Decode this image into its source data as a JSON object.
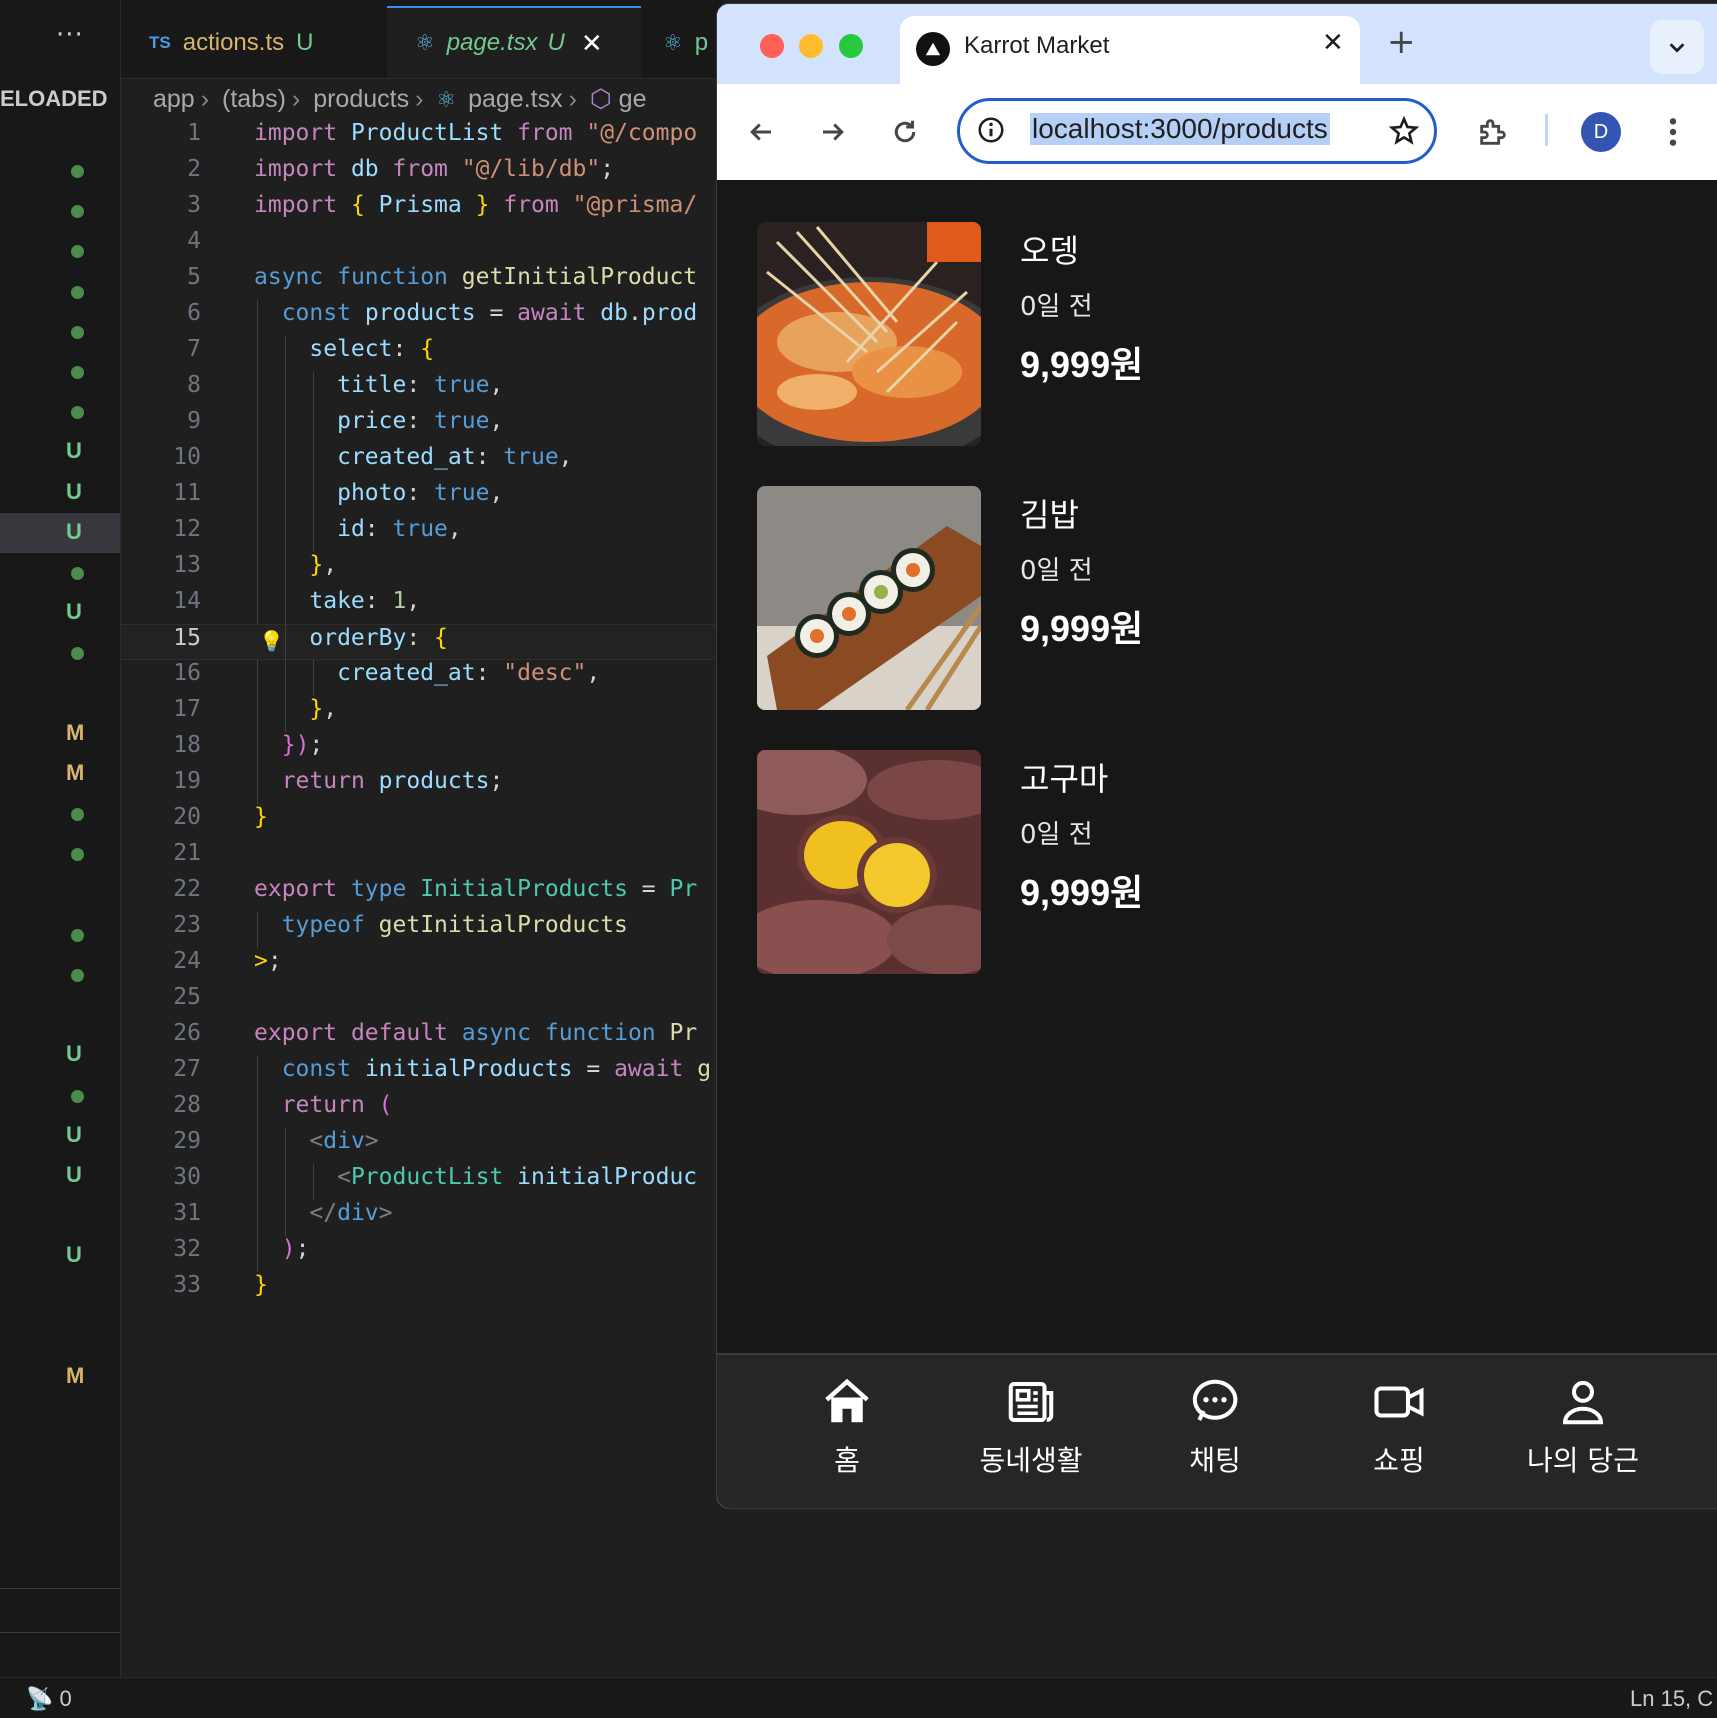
{
  "vscode": {
    "scm_title": "ELOADED",
    "scm_markers": [
      "dot",
      "dot",
      "dot",
      "dot",
      "dot",
      "dot",
      "dot",
      "U",
      "U",
      "U",
      "dot",
      "U",
      "dot",
      "",
      "M",
      "M",
      "dot",
      "dot",
      "",
      "dot",
      "dot",
      "",
      "U",
      "dot",
      "U",
      "U",
      "",
      "U",
      "",
      "",
      "M"
    ],
    "tabs": [
      {
        "prefix": "TS",
        "label": "actions.ts",
        "status": "U"
      },
      {
        "label": "page.tsx",
        "status": "U",
        "close": "✕"
      },
      {
        "label": "p"
      }
    ],
    "breadcrumb": [
      "app",
      "(tabs)",
      "products",
      "page.tsx",
      "ge"
    ],
    "current_line": 15,
    "status_left": "0",
    "status_right": "Ln 15, C"
  },
  "browser": {
    "tab_title": "Karrot Market",
    "tab_close": "✕",
    "new_tab": "+",
    "url": "localhost:3000/products",
    "profile_initial": "D"
  },
  "products": [
    {
      "title": "오뎅",
      "time": "0일 전",
      "price": "9,999원"
    },
    {
      "title": "김밥",
      "time": "0일 전",
      "price": "9,999원"
    },
    {
      "title": "고구마",
      "time": "0일 전",
      "price": "9,999원"
    }
  ],
  "nav": [
    {
      "label": "홈",
      "icon": "home-icon"
    },
    {
      "label": "동네생활",
      "icon": "newspaper-icon"
    },
    {
      "label": "채팅",
      "icon": "chat-icon"
    },
    {
      "label": "쇼핑",
      "icon": "video-camera-icon"
    },
    {
      "label": "나의 당근",
      "icon": "user-icon"
    }
  ],
  "colors": {
    "accent": "#3b8eea",
    "untracked": "#73c991",
    "modified": "#d7b56d",
    "page_bg": "#171717"
  }
}
